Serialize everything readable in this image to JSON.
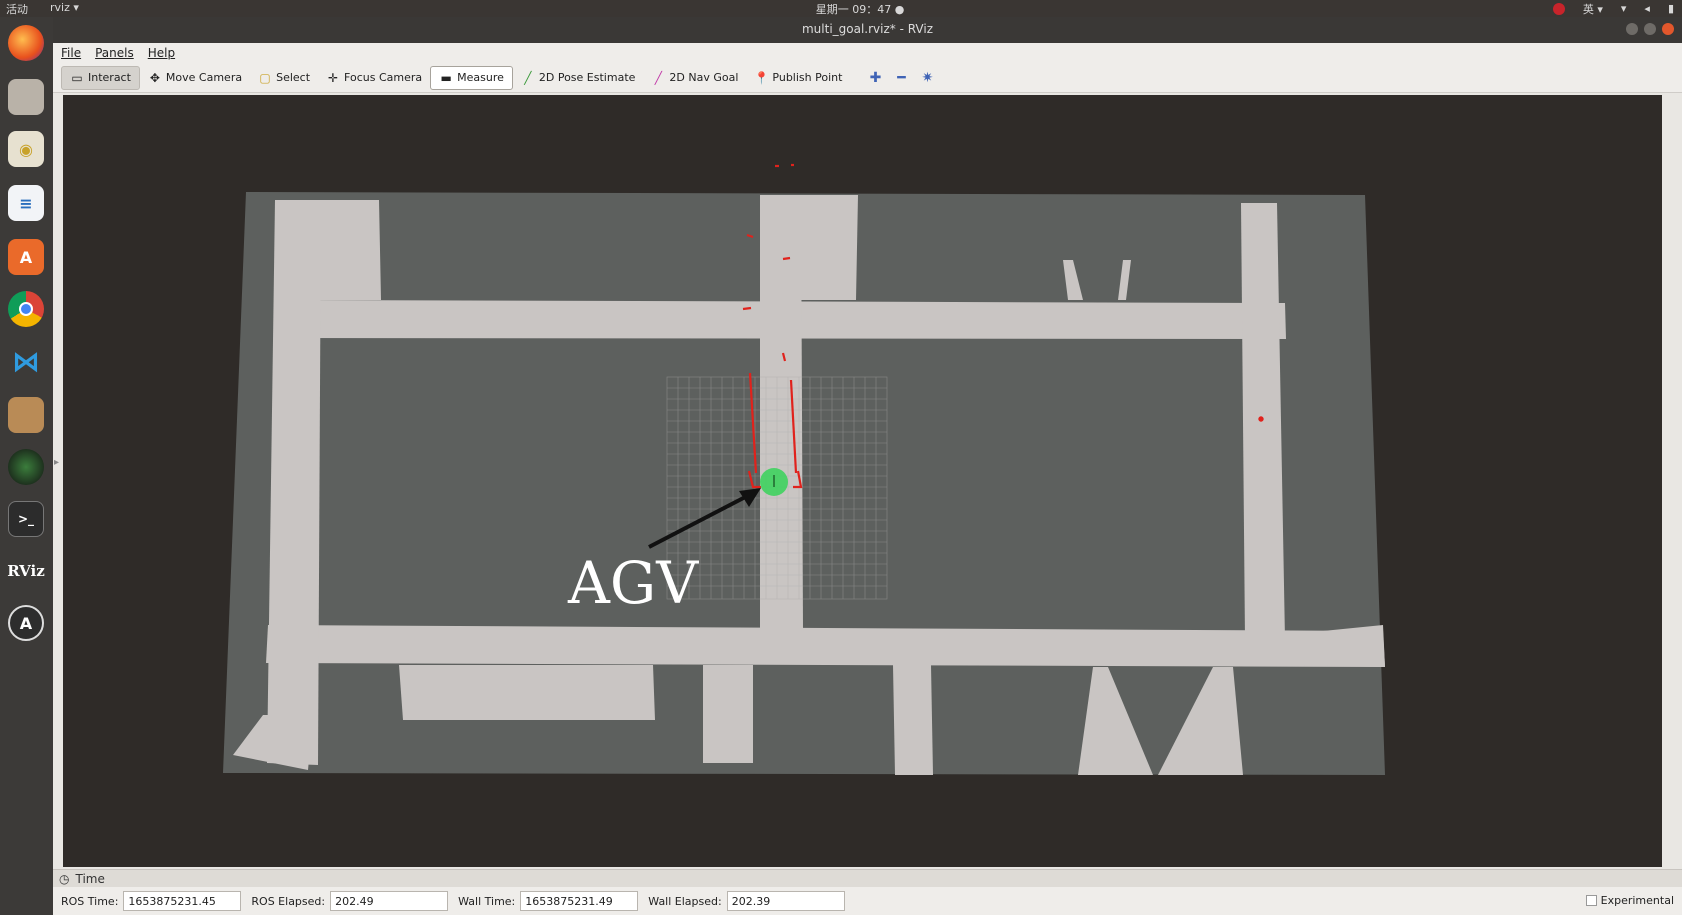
{
  "topbar": {
    "activities": "活动",
    "app_menu": "rviz ▾",
    "clock": "星期一 09：47 ●",
    "tray_lang": "英 ▾",
    "tray_icons": [
      "network-icon",
      "volume-icon",
      "battery-icon"
    ]
  },
  "window": {
    "title": "multi_goal.rviz* - RViz"
  },
  "menubar": {
    "file": "File",
    "panels": "Panels",
    "help": "Help"
  },
  "toolbar": {
    "tools": [
      {
        "label": "Interact",
        "icon": "interact-icon"
      },
      {
        "label": "Move Camera",
        "icon": "move-camera-icon"
      },
      {
        "label": "Select",
        "icon": "select-icon"
      },
      {
        "label": "Focus Camera",
        "icon": "focus-camera-icon"
      },
      {
        "label": "Measure",
        "icon": "measure-icon"
      },
      {
        "label": "2D Pose Estimate",
        "icon": "pose-estimate-icon"
      },
      {
        "label": "2D Nav Goal",
        "icon": "nav-goal-icon"
      },
      {
        "label": "Publish Point",
        "icon": "publish-point-icon"
      }
    ],
    "active_tool": "Interact",
    "selected_tool": "Measure"
  },
  "viewport": {
    "annotation": "AGV",
    "colors": {
      "background": "#2f2b28",
      "map_unknown": "#5d605e",
      "map_free": "#c9c5c3",
      "laser": "#e0221c",
      "robot": "#3fd15f",
      "grid": "#a9a9a9"
    }
  },
  "time_panel": {
    "title": "Time",
    "ros_time_label": "ROS Time:",
    "ros_time": "1653875231.45",
    "ros_elapsed_label": "ROS Elapsed:",
    "ros_elapsed": "202.49",
    "wall_time_label": "Wall Time:",
    "wall_time": "1653875231.49",
    "wall_elapsed_label": "Wall Elapsed:",
    "wall_elapsed": "202.39",
    "experimental_label": "Experimental"
  }
}
